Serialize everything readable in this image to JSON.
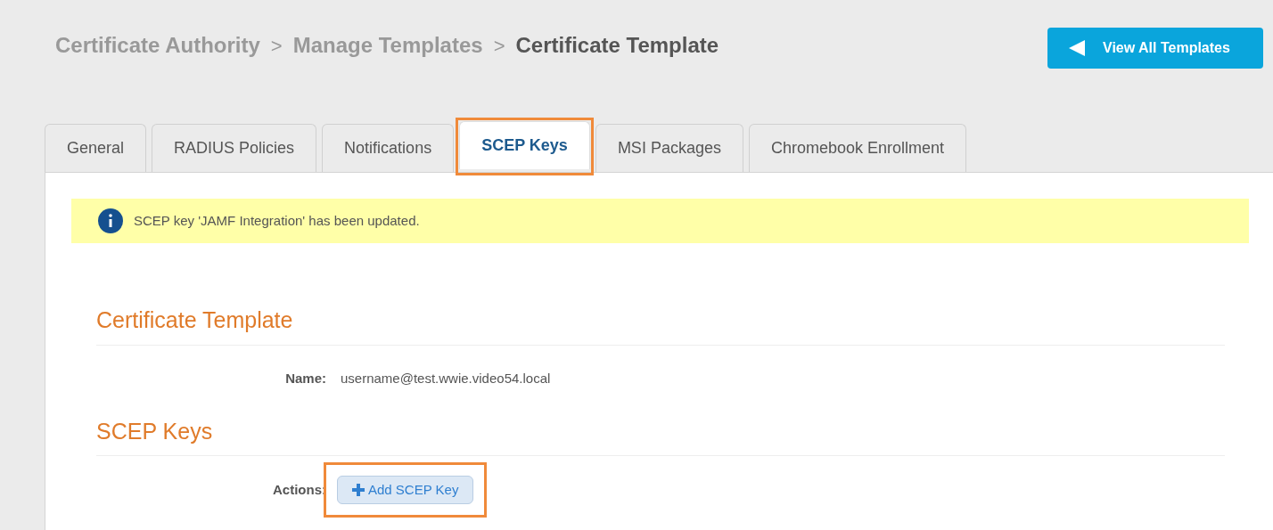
{
  "breadcrumb": [
    {
      "label": "Certificate Authority",
      "current": false
    },
    {
      "label": "Manage Templates",
      "current": false
    },
    {
      "label": "Certificate Template",
      "current": true
    }
  ],
  "breadcrumb_separator": ">",
  "view_all_button": {
    "label": "View All Templates"
  },
  "tabs": [
    {
      "label": "General",
      "selected": false,
      "highlighted": false
    },
    {
      "label": "RADIUS Policies",
      "selected": false,
      "highlighted": false
    },
    {
      "label": "Notifications",
      "selected": false,
      "highlighted": false
    },
    {
      "label": "SCEP Keys",
      "selected": true,
      "highlighted": true
    },
    {
      "label": "MSI Packages",
      "selected": false,
      "highlighted": false
    },
    {
      "label": "Chromebook Enrollment",
      "selected": false,
      "highlighted": false
    }
  ],
  "alert": {
    "message": "SCEP key 'JAMF Integration' has been updated."
  },
  "sections": [
    {
      "heading": "Certificate Template",
      "fields": [
        {
          "kind": "text",
          "label": "Name:",
          "value": "username@test.wwie.video54.local"
        }
      ]
    },
    {
      "heading": "SCEP Keys",
      "fields": [
        {
          "kind": "button",
          "label": "Actions:",
          "value": "Add SCEP Key",
          "highlighted": true
        }
      ]
    }
  ]
}
